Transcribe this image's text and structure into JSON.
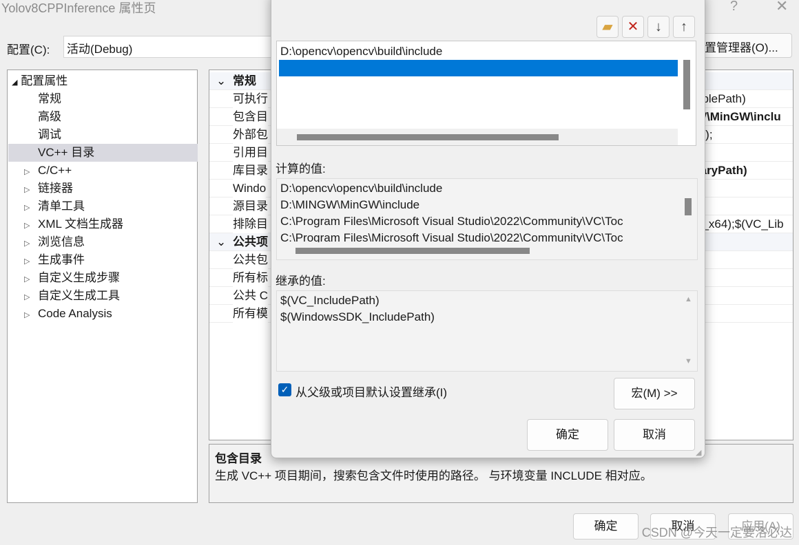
{
  "window": {
    "title": "Yolov8CPPInference 属性页",
    "help": "?",
    "close": "✕"
  },
  "config": {
    "label": "配置(C):",
    "value": "活动(Debug)",
    "manager": "置管理器(O)..."
  },
  "tree": {
    "root": "配置属性",
    "items": [
      {
        "label": "常规",
        "expand": false
      },
      {
        "label": "高级",
        "expand": false
      },
      {
        "label": "调试",
        "expand": false
      },
      {
        "label": "VC++ 目录",
        "expand": false,
        "selected": true
      },
      {
        "label": "C/C++",
        "expand": true
      },
      {
        "label": "链接器",
        "expand": true
      },
      {
        "label": "清单工具",
        "expand": true
      },
      {
        "label": "XML 文档生成器",
        "expand": true
      },
      {
        "label": "浏览信息",
        "expand": true
      },
      {
        "label": "生成事件",
        "expand": true
      },
      {
        "label": "自定义生成步骤",
        "expand": true
      },
      {
        "label": "自定义生成工具",
        "expand": true
      },
      {
        "label": "Code Analysis",
        "expand": true
      }
    ]
  },
  "grid": {
    "rows": [
      {
        "type": "header",
        "name": "常规"
      },
      {
        "name": "可执行",
        "value": "ablePath)",
        "bold": false
      },
      {
        "name": "包含目",
        "value": "W\\MinGW\\inclu",
        "bold": true
      },
      {
        "name": "外部包",
        "value": "th);",
        "bold": false
      },
      {
        "name": "引用目",
        "value": "",
        "bold": false
      },
      {
        "name": "库目录",
        "value": "raryPath)",
        "bold": true
      },
      {
        "name": "Windo",
        "value": "",
        "bold": false
      },
      {
        "name": "源目录",
        "value": "",
        "bold": false
      },
      {
        "name": "排除目",
        "value": "n_x64);$(VC_Lib",
        "bold": false
      },
      {
        "type": "header",
        "name": "公共项"
      },
      {
        "name": "公共包",
        "value": ""
      },
      {
        "name": "所有标",
        "value": ""
      },
      {
        "name": "公共 C",
        "value": ""
      },
      {
        "name": "所有模",
        "value": ""
      }
    ]
  },
  "description": {
    "title": "包含目录",
    "text": "生成 VC++ 项目期间，搜索包含文件时使用的路径。 与环境变量 INCLUDE 相对应。"
  },
  "footer": {
    "ok": "确定",
    "cancel": "取消",
    "apply": "应用(A)"
  },
  "dialog": {
    "toolbar": {
      "new": "new-folder",
      "delete": "delete",
      "down": "move-down",
      "up": "move-up"
    },
    "entries": [
      "D:\\opencv\\opencv\\build\\include",
      ""
    ],
    "computed_label": "计算的值:",
    "computed": [
      "D:\\opencv\\opencv\\build\\include",
      "D:\\MINGW\\MinGW\\include",
      "C:\\Program Files\\Microsoft Visual Studio\\2022\\Community\\VC\\Toc",
      "C:\\Program Files\\Microsoft Visual Studio\\2022\\Community\\VC\\Toc"
    ],
    "inherited_label": "继承的值:",
    "inherited": [
      "$(VC_IncludePath)",
      "$(WindowsSDK_IncludePath)"
    ],
    "inherit_checkbox": {
      "label": "从父级或项目默认设置继承(I)",
      "checked": true
    },
    "macro": "宏(M) >>",
    "ok": "确定",
    "cancel": "取消"
  },
  "watermark": "CSDN @今天一定要洛必达",
  "colors": {
    "selection": "#0078d7",
    "checkbox": "#005fb8"
  }
}
